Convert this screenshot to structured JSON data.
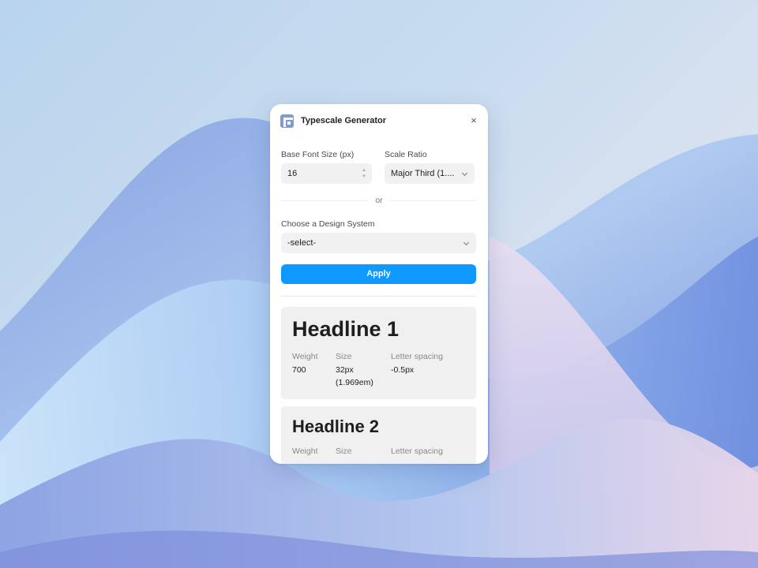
{
  "window": {
    "title": "Typescale Generator",
    "close_icon": "×"
  },
  "form": {
    "base_font_label": "Base Font Size (px)",
    "base_font_value": "16",
    "scale_ratio_label": "Scale Ratio",
    "scale_ratio_value": "Major Third (1....",
    "divider_text": "or",
    "design_system_label": "Choose a Design System",
    "design_system_value": "-select-",
    "apply_label": "Apply"
  },
  "cards": [
    {
      "name": "Headline 1",
      "weight_label": "Weight",
      "weight": "700",
      "size_label": "Size",
      "size_px": "32px",
      "size_em": "(1.969em)",
      "spacing_label": "Letter spacing",
      "spacing": "-0.5px"
    },
    {
      "name": "Headline 2",
      "weight_label": "Weight",
      "size_label": "Size",
      "spacing_label": "Letter spacing"
    }
  ],
  "colors": {
    "accent": "#0d99ff",
    "panel": "#ffffff",
    "field_bg": "#f1f1f1",
    "card_bg": "#f0f0f0"
  }
}
